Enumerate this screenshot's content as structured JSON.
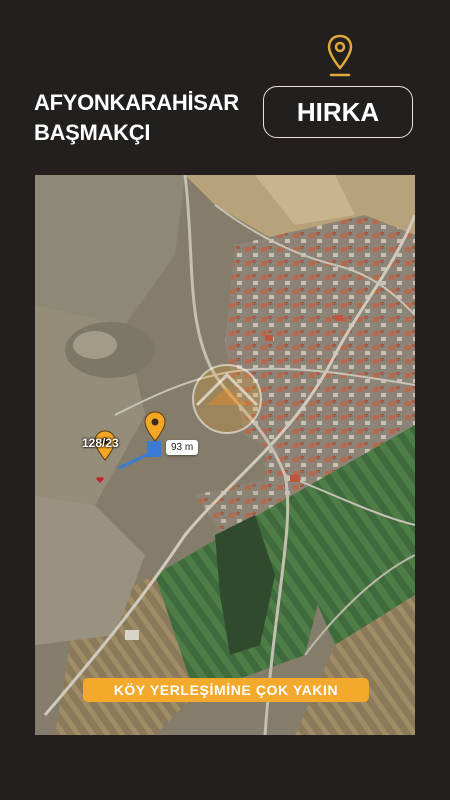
{
  "header": {
    "province": "AFYONKARAHİSAR",
    "district": "BAŞMAKÇI",
    "village": "HIRKA",
    "pin_icon": "location-pin-icon",
    "accent_color": "#e0a93a"
  },
  "map": {
    "type": "satellite",
    "parcel_label": "128/23",
    "distance_label": "93 m",
    "banner_text": "KÖY YERLEŞİMİNE ÇOK YAKIN",
    "markers": [
      "parcel-marker",
      "road-marker"
    ],
    "marker_color": "#f5a623",
    "measure_line_color": "#3a7bd5",
    "banner_color": "#f3a92c"
  }
}
